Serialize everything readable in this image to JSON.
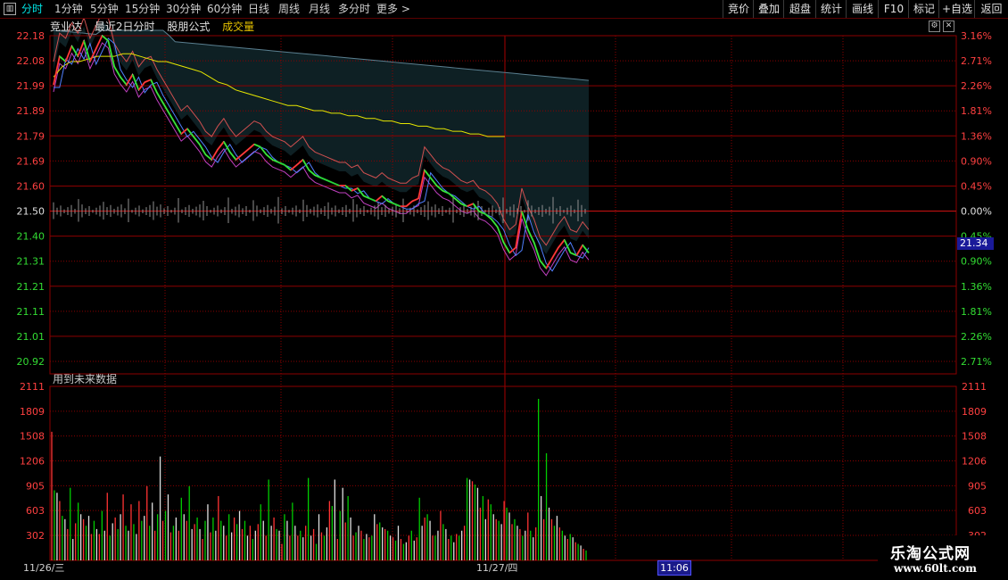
{
  "toolbar": {
    "tabs": [
      "分时",
      "1分钟",
      "5分钟",
      "15分钟",
      "30分钟",
      "60分钟",
      "日线",
      "周线",
      "月线",
      "多分时",
      "更多 >"
    ],
    "right_buttons": [
      "竞价",
      "叠加",
      "超盘",
      "统计",
      "画线",
      "F10",
      "标记",
      "+自选",
      "返回"
    ]
  },
  "info": {
    "name": "竞业达",
    "period": "最近2日分时",
    "formula": "股朋公式",
    "volume": "成交量"
  },
  "hint": "用到未来数据",
  "price_axis": {
    "left": [
      "22.18",
      "22.08",
      "21.99",
      "21.89",
      "21.79",
      "21.69",
      "21.60",
      "21.50",
      "21.40",
      "21.31",
      "21.21",
      "21.11",
      "21.01",
      "20.92"
    ],
    "right": [
      "3.16%",
      "2.71%",
      "2.26%",
      "1.81%",
      "1.36%",
      "0.90%",
      "0.45%",
      "0.00%",
      "0.45%",
      "0.90%",
      "1.36%",
      "1.81%",
      "2.26%",
      "2.71%"
    ]
  },
  "volume_axis": [
    "2111",
    "1809",
    "1508",
    "1206",
    "905",
    "603",
    "302"
  ],
  "dates": [
    "11/26/三",
    "11/27/四"
  ],
  "time_label": "11:06",
  "current_price": "21.34",
  "watermark": {
    "line1": "乐淘公式网",
    "line2": "www.60lt.com"
  },
  "colors": {
    "up": "#ff3333",
    "down": "#00cc00",
    "grid": "#8b0000",
    "price_line": "#ffffff",
    "avg_line": "#e6e600",
    "cloud": "#0f2226"
  },
  "chart_data": {
    "type": "line",
    "series": [
      {
        "values": [
          21.99,
          22.1,
          22.08,
          22.14,
          22.1,
          22.16,
          22.08,
          22.13,
          22.18,
          22.16,
          22.06,
          22.02,
          21.99,
          22.03,
          21.97,
          22.0,
          22.01,
          21.96,
          21.92,
          21.88,
          21.84,
          21.8,
          21.82,
          21.79,
          21.76,
          21.72,
          21.7,
          21.74,
          21.77,
          21.73,
          21.7,
          21.72,
          21.74,
          21.76,
          21.75,
          21.72,
          21.7,
          21.69,
          21.68,
          21.66,
          21.68,
          21.7,
          21.66,
          21.64,
          21.63,
          21.62,
          21.61,
          21.6,
          21.6,
          21.58,
          21.59,
          21.56,
          21.55,
          21.54,
          21.56,
          21.54,
          21.53,
          21.52,
          21.52,
          21.54,
          21.55,
          21.66,
          21.63,
          21.6,
          21.58,
          21.57,
          21.55,
          21.53,
          21.52,
          21.53,
          21.5,
          21.49,
          21.47,
          21.44,
          21.38,
          21.34,
          21.36,
          21.5,
          21.43,
          21.38,
          21.31,
          21.28,
          21.32,
          21.36,
          21.39,
          21.34,
          21.33,
          21.37,
          21.34
        ]
      },
      {
        "values": [
          22.02,
          22.06,
          22.08,
          22.08,
          22.09,
          22.1,
          22.1,
          22.1,
          22.11,
          22.11,
          22.1,
          22.09,
          22.08,
          22.08,
          22.07,
          22.06,
          22.05,
          22.04,
          22.02,
          22.0,
          21.99,
          21.97,
          21.96,
          21.95,
          21.94,
          21.93,
          21.92,
          21.91,
          21.91,
          21.9,
          21.89,
          21.89,
          21.88,
          21.88,
          21.87,
          21.87,
          21.86,
          21.86,
          21.85,
          21.85,
          21.84,
          21.84,
          21.83,
          21.83,
          21.82,
          21.82,
          21.81,
          21.81,
          21.8,
          21.8,
          21.79,
          21.79,
          21.79
        ]
      }
    ],
    "volume": [
      1560,
      850,
      820,
      720,
      540,
      500,
      380,
      880,
      260,
      450,
      700,
      560,
      500,
      420,
      540,
      320,
      480,
      380,
      320,
      600,
      360,
      820,
      300,
      450,
      520,
      380,
      560,
      800,
      420,
      360,
      680,
      440,
      320,
      720,
      480,
      540,
      900,
      420,
      700,
      360,
      560,
      1260,
      480,
      600,
      800,
      340,
      420,
      520,
      360,
      760,
      560,
      480,
      900,
      380,
      440,
      520,
      380,
      260,
      480,
      680,
      340,
      520,
      360,
      780,
      480,
      420,
      300,
      560,
      340,
      520,
      440,
      600,
      380,
      480,
      300,
      420,
      260,
      360,
      440,
      680,
      480,
      300,
      980,
      420,
      520,
      380,
      360,
      200,
      560,
      480,
      300,
      700,
      420,
      300,
      360,
      280,
      420,
      1000,
      300,
      380,
      200,
      560,
      340,
      300,
      400,
      720,
      660,
      980,
      260,
      600,
      880,
      460,
      780,
      520,
      300,
      340,
      420,
      360,
      260,
      320,
      280,
      300,
      560,
      440,
      460,
      400,
      380,
      360,
      300,
      280,
      240,
      420,
      260,
      200,
      220,
      300,
      360,
      240,
      280,
      760,
      420,
      520,
      560,
      480,
      300,
      300,
      360,
      600,
      440,
      380,
      260,
      300,
      220,
      320,
      300,
      360,
      420,
      1000,
      980,
      960,
      920,
      880,
      640,
      780,
      500,
      740,
      680,
      560,
      500,
      480,
      440,
      720,
      640,
      580,
      440,
      500,
      420,
      380,
      300,
      360,
      580,
      360,
      280,
      400,
      1960,
      780,
      500,
      1300,
      640,
      500,
      420,
      540,
      400,
      360,
      300,
      260,
      320,
      280,
      220,
      200,
      180,
      140,
      120
    ],
    "ylim": [
      20.92,
      22.18
    ],
    "volume_ylim": [
      0,
      2111
    ]
  }
}
